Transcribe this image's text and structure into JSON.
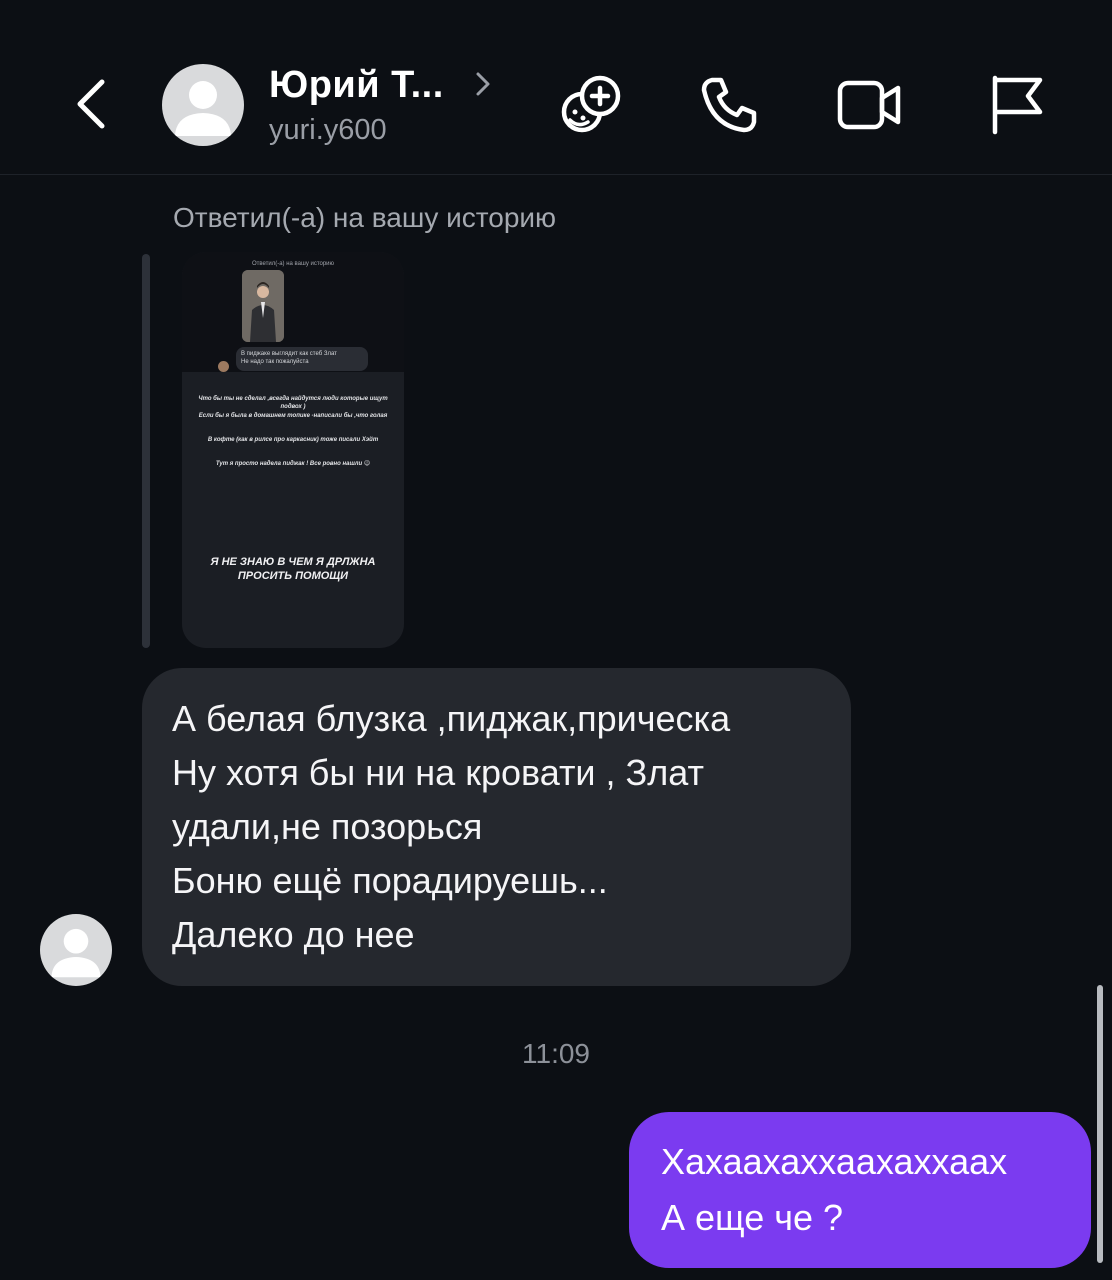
{
  "header": {
    "contact_name": "Юрий Т...",
    "contact_handle": "yuri.y600",
    "icons": [
      "back-arrow-icon",
      "chevron-right-icon",
      "games-icon",
      "phone-icon",
      "video-camera-icon",
      "flag-icon"
    ]
  },
  "story_reply": {
    "label": "Ответил(-а) на вашу историю",
    "preview": {
      "reply_label": "Ответил(-а) на вашу историю",
      "bubble_line1": "В пиджаке выглядит как стеб Злат",
      "bubble_line2": "Не надо так пожалуйста",
      "text1": "Что бы ты не сделал ,всегда найдутся люди которые ищут подвох )",
      "text2": "Если бы я была в домашнем топике -написали бы ,что голая",
      "text3": "В кофте (как в рилсе про каркасник) тоже писали Хэйт",
      "text4": "Тут я просто надела пиджак ! Все ровно нашли 😉",
      "big_text": "Я НЕ ЗНАЮ В ЧЕМ Я ДРЛЖНА ПРОСИТЬ ПОМОЩИ"
    }
  },
  "messages": {
    "incoming": [
      "А белая блузка ,пиджак,прическа",
      "Ну хотя бы ни на кровати , Злат",
      "удали,не позорься",
      "Боню ещё порадируешь...",
      "Далеко до нее"
    ],
    "timestamp": "11:09",
    "outgoing": [
      "Хахаахаххаахаххаах",
      "А еще че ?"
    ]
  },
  "colors": {
    "background": "#0c0f14",
    "incoming_bubble": "#25282e",
    "outgoing_bubble": "#7b3bf0",
    "secondary_text": "#9a9ea6"
  }
}
